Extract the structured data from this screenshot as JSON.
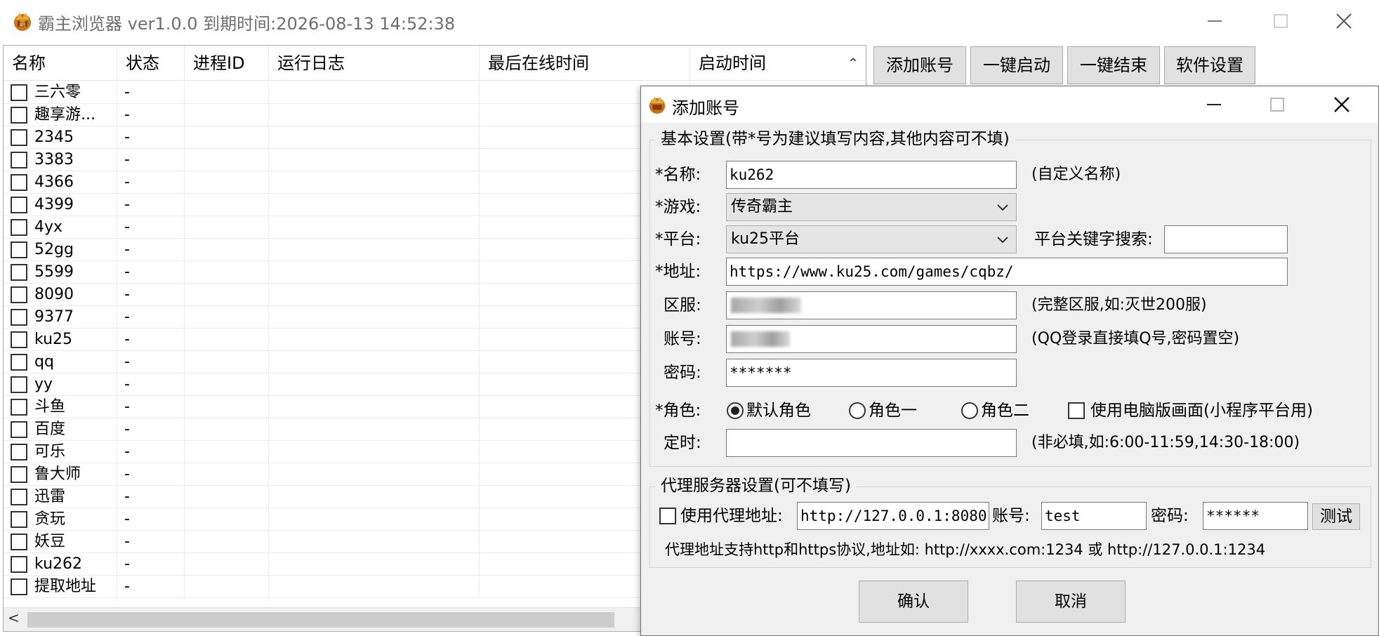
{
  "window": {
    "title": "霸主浏览器 ver1.0.0 到期时间:2026-08-13 14:52:38"
  },
  "grid": {
    "columns": [
      "名称",
      "状态",
      "进程ID",
      "运行日志",
      "最后在线时间",
      "启动时间"
    ],
    "rows": [
      {
        "name": "三六零",
        "status": "-"
      },
      {
        "name": "趣享游...",
        "status": "-"
      },
      {
        "name": "2345",
        "status": "-"
      },
      {
        "name": "3383",
        "status": "-"
      },
      {
        "name": "4366",
        "status": "-"
      },
      {
        "name": "4399",
        "status": "-"
      },
      {
        "name": "4yx",
        "status": "-"
      },
      {
        "name": "52gg",
        "status": "-"
      },
      {
        "name": "5599",
        "status": "-"
      },
      {
        "name": "8090",
        "status": "-"
      },
      {
        "name": "9377",
        "status": "-"
      },
      {
        "name": "ku25",
        "status": "-"
      },
      {
        "name": "qq",
        "status": "-"
      },
      {
        "name": "yy",
        "status": "-"
      },
      {
        "name": "斗鱼",
        "status": "-"
      },
      {
        "name": "百度",
        "status": "-"
      },
      {
        "name": "可乐",
        "status": "-"
      },
      {
        "name": "鲁大师",
        "status": "-"
      },
      {
        "name": "迅雷",
        "status": "-"
      },
      {
        "name": "贪玩",
        "status": "-"
      },
      {
        "name": "妖豆",
        "status": "-"
      },
      {
        "name": "ku262",
        "status": "-"
      },
      {
        "name": "提取地址",
        "status": "-"
      }
    ]
  },
  "toolbar": {
    "add_account": "添加账号",
    "start_all": "一键启动",
    "stop_all": "一键结束",
    "settings": "软件设置"
  },
  "dialog": {
    "title": "添加账号",
    "basic": {
      "group_title": "基本设置(带*号为建议填写内容,其他内容可不填)",
      "name_label": "*名称:",
      "name_value": "ku262",
      "name_hint": "(自定义名称)",
      "game_label": "*游戏:",
      "game_value": "传奇霸主",
      "platform_label": "*平台:",
      "platform_value": "ku25平台",
      "platform_search_label": "平台关键字搜索:",
      "platform_search_value": "",
      "url_label": "*地址:",
      "url_value": "https://www.ku25.com/games/cqbz/",
      "server_label": "区服:",
      "server_hint": "(完整区服,如:灭世200服)",
      "account_label": "账号:",
      "account_hint": "(QQ登录直接填Q号,密码置空)",
      "password_label": "密码:",
      "password_value": "*******",
      "role_label": "*角色:",
      "role_options": [
        "默认角色",
        "角色一",
        "角色二"
      ],
      "pc_mode_label": "使用电脑版画面(小程序平台用)",
      "timer_label": "定时:",
      "timer_value": "",
      "timer_hint": "(非必填,如:6:00-11:59,14:30-18:00)"
    },
    "proxy": {
      "group_title": "代理服务器设置(可不填写)",
      "use_proxy_label": "使用代理地址:",
      "address_value": "http://127.0.0.1:8080",
      "account_label": "账号:",
      "account_value": "test",
      "password_label": "密码:",
      "password_value": "******",
      "test_button": "测试",
      "note": "代理地址支持http和https协议,地址如: http://xxxx.com:1234 或 http://127.0.0.1:1234"
    },
    "confirm": "确认",
    "cancel": "取消"
  }
}
